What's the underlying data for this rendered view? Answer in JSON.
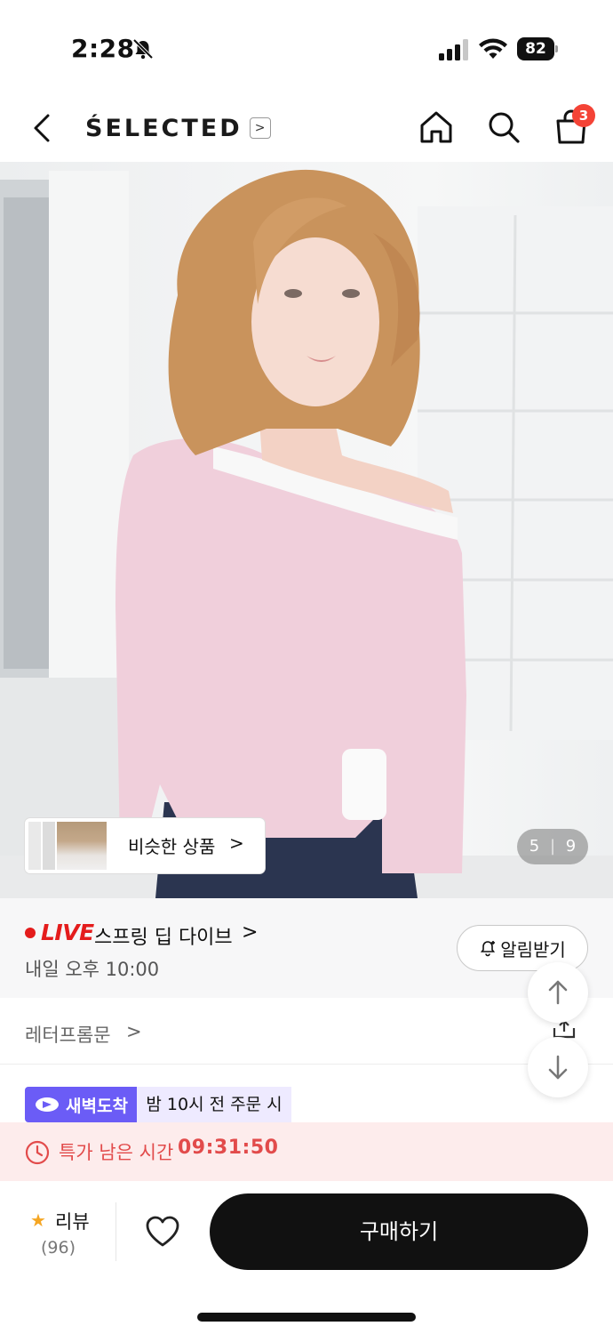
{
  "status_bar": {
    "time": "2:28",
    "battery": "82"
  },
  "header": {
    "brand": "ŚELECTED",
    "cart_count": "3"
  },
  "gallery": {
    "similar_label": "비슷한 상품",
    "counter_current": "5",
    "counter_sep": "|",
    "counter_total": "9"
  },
  "live": {
    "badge": "LIVE",
    "title": "스프링 딥 다이브",
    "time": "내일 오후 10:00",
    "alarm_label": "알림받기"
  },
  "seller": {
    "name": "레터프롬문"
  },
  "delivery": {
    "badge": "새벽도착",
    "note": "밤 10시 전 주문 시"
  },
  "timer": {
    "label": "특가 남은 시간",
    "value": "09:31:50"
  },
  "bottom_bar": {
    "review_label": "리뷰",
    "review_count": "(96)",
    "buy_label": "구매하기"
  },
  "colors": {
    "live_red": "#e41c1c",
    "badge_purple": "#6b5cf6",
    "timer_red": "#e24b4b",
    "buy_black": "#111111",
    "star": "#f5a623"
  }
}
